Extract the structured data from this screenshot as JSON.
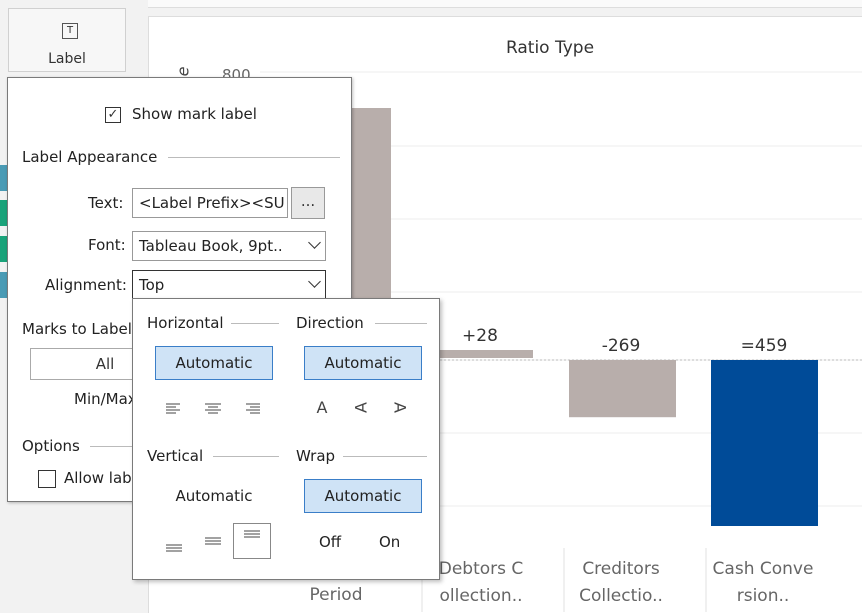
{
  "shelf": {
    "label_card": {
      "label": "Label",
      "icon_glyph": "T"
    }
  },
  "chart": {
    "title": "Ratio Type",
    "y_label_partial": "e",
    "y_tick_partial": "800"
  },
  "chart_data": {
    "type": "bar",
    "title": "Ratio Type",
    "categories": [
      "Period",
      "Debtors Collection..",
      "Creditors Collectio..",
      "Cash Conversion.."
    ],
    "category_lines": [
      [
        "Period"
      ],
      [
        "Debtors C",
        "ollection.."
      ],
      [
        "Creditors",
        "Collectio.."
      ],
      [
        "Cash Conve",
        "rsion.."
      ]
    ],
    "values": [
      null,
      28,
      -269,
      459
    ],
    "data_labels": [
      "",
      "+28",
      "-269",
      "=459"
    ],
    "colors": [
      "#b8aeab",
      "#b8aeab",
      "#b8aeab",
      "#004b98"
    ]
  },
  "popup": {
    "show_mark_label": "Show mark label",
    "show_mark_label_checked": true,
    "label_appearance": "Label Appearance",
    "text_label": "Text:",
    "text_value": "<Label Prefix><SU",
    "ellipsis_button": "...",
    "font_label": "Font:",
    "font_value": "Tableau Book, 9pt..",
    "alignment_label": "Alignment:",
    "alignment_value": "Top",
    "marks_to_label": "Marks to Label",
    "all_button": "All",
    "min_max": "Min/Max",
    "options": "Options",
    "allow_label": "Allow lab"
  },
  "alignment": {
    "horizontal": "Horizontal",
    "direction": "Direction",
    "horizontal_value": "Automatic",
    "direction_value": "Automatic",
    "vertical": "Vertical",
    "wrap": "Wrap",
    "vertical_value": "Automatic",
    "wrap_value": "Automatic",
    "wrap_off": "Off",
    "wrap_on": "On",
    "direction_glyphs": [
      "A",
      "A",
      "A"
    ]
  },
  "colors": {
    "accent": "#cfe3f6",
    "accent_border": "#3a7ec8",
    "bar_gray": "#b8aeab",
    "bar_blue": "#004b98"
  }
}
